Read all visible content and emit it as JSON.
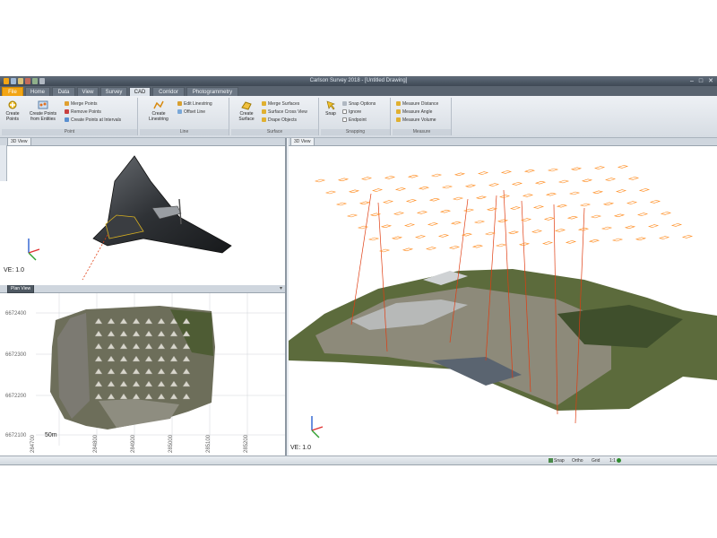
{
  "window": {
    "title": "Carlson Survey 2018 - [Untitled Drawing]",
    "controls": [
      "–",
      "□",
      "✕"
    ]
  },
  "quick_access_icons": [
    "save-icon",
    "undo-icon",
    "redo-icon",
    "print-icon",
    "settings-icon"
  ],
  "ribbon": {
    "tabs": [
      "File",
      "Home",
      "Data",
      "View",
      "Survey",
      "CAD",
      "Corridor",
      "Photogrammetry"
    ],
    "active_tab": "CAD",
    "groups": {
      "point": {
        "label": "Point",
        "create_points": "Create Points",
        "create_points_from_entities": "Create Points from Entities",
        "merge_points": "Merge Points",
        "remove_points": "Remove Points",
        "create_points_photos": "Create Points at Intervals"
      },
      "line": {
        "label": "Line",
        "create_linestring": "Create Linestring",
        "edit_linestring": "Edit Linestring",
        "offset_line": "Offset Line"
      },
      "surface": {
        "label": "Surface",
        "create_surface": "Create Surface",
        "merge_surfaces": "Merge Surfaces",
        "surface_cross_section": "Surface Cross View",
        "drape_objects": "Drape Objects"
      },
      "snapping": {
        "label": "Snapping",
        "snap": "Snap",
        "snap_options": "Snap Options",
        "ignore": "Ignore",
        "endpoint": "Endpoint"
      },
      "measure": {
        "label": "Measure",
        "measure_distance": "Measure Distance",
        "measure_angle": "Measure Angle",
        "measure_volume": "Measure Volume"
      }
    }
  },
  "panes": {
    "top_left": {
      "tab": "3D View",
      "ve": "VE: 1.0"
    },
    "bottom_left": {
      "tab": "Plan View",
      "y_ticks": [
        "6672400",
        "6672300",
        "6672200",
        "6672100"
      ],
      "x_ticks": [
        "284700",
        "284800",
        "284900",
        "285000",
        "285100",
        "285200"
      ],
      "scale_label": "50m"
    },
    "right": {
      "tab": "3D View",
      "ve": "VE: 1.0"
    }
  },
  "statusbar": {
    "items": [
      "Snap",
      "Ortho",
      "Grid"
    ],
    "zoom": "1:1"
  },
  "colors": {
    "file_tab": "#f2a515",
    "ribbon_bg": "#e3e8ee",
    "camera_orange": "#ff8a1c",
    "ray_red": "#e03c10",
    "titlebar": "#4b5663"
  }
}
